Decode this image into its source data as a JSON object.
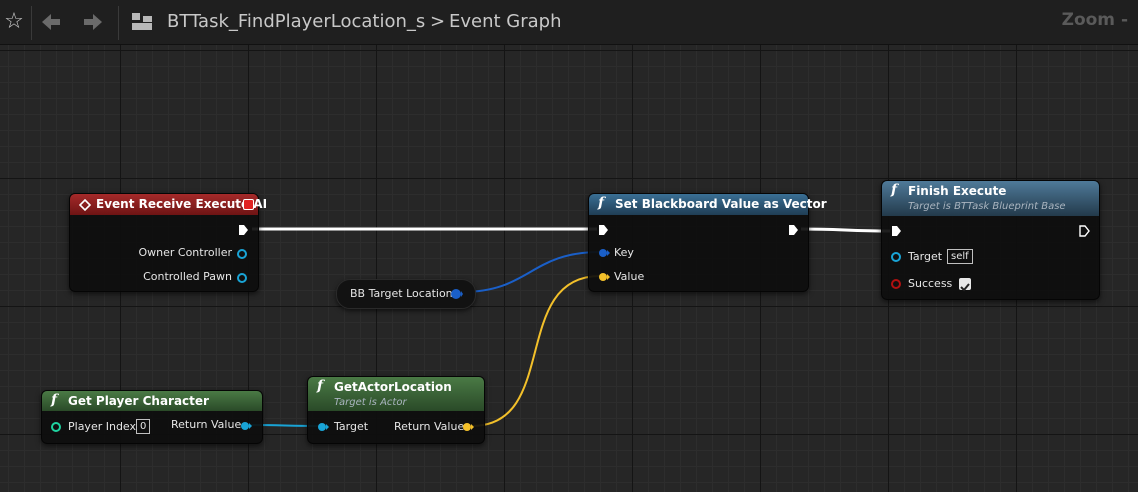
{
  "toolbar": {
    "breadcrumb_blueprint": "BTTask_FindPlayerLocation_s",
    "breadcrumb_separator": ">",
    "breadcrumb_graph": "Event Graph",
    "zoom_label": "Zoom -",
    "icons": [
      "star-icon",
      "back-arrow-icon",
      "forward-arrow-icon",
      "blueprint-graph-icon"
    ]
  },
  "nodes": {
    "event_receive_execute_ai": {
      "title": "Event Receive Execute AI",
      "pins": {
        "owner_controller": "Owner Controller",
        "controlled_pawn": "Controlled Pawn"
      }
    },
    "bb_target_location": {
      "title": "BB Target Location"
    },
    "set_blackboard_value": {
      "title": "Set Blackboard Value as Vector",
      "pins": {
        "key": "Key",
        "value": "Value"
      }
    },
    "finish_execute": {
      "title": "Finish Execute",
      "subtitle": "Target is BTTask Blueprint Base",
      "pins": {
        "target": "Target",
        "target_default": "self",
        "success": "Success"
      }
    },
    "get_player_character": {
      "title": "Get Player Character",
      "pins": {
        "player_index": "Player Index",
        "player_index_value": "0",
        "return_value": "Return Value"
      }
    },
    "get_actor_location": {
      "title": "GetActorLocation",
      "subtitle": "Target is Actor",
      "pins": {
        "target": "Target",
        "return_value": "Return Value"
      }
    }
  },
  "colors": {
    "event_header": "#8a1c1c",
    "function_header": "#2e5a7a",
    "pure_header": "#3c6637",
    "exec_wire": "#ffffff",
    "object_pin": "#19a4d6",
    "vector_pin": "#f3c02a",
    "blackboard_key_pin": "#1a5fc8",
    "success_pin": "#b01010"
  }
}
